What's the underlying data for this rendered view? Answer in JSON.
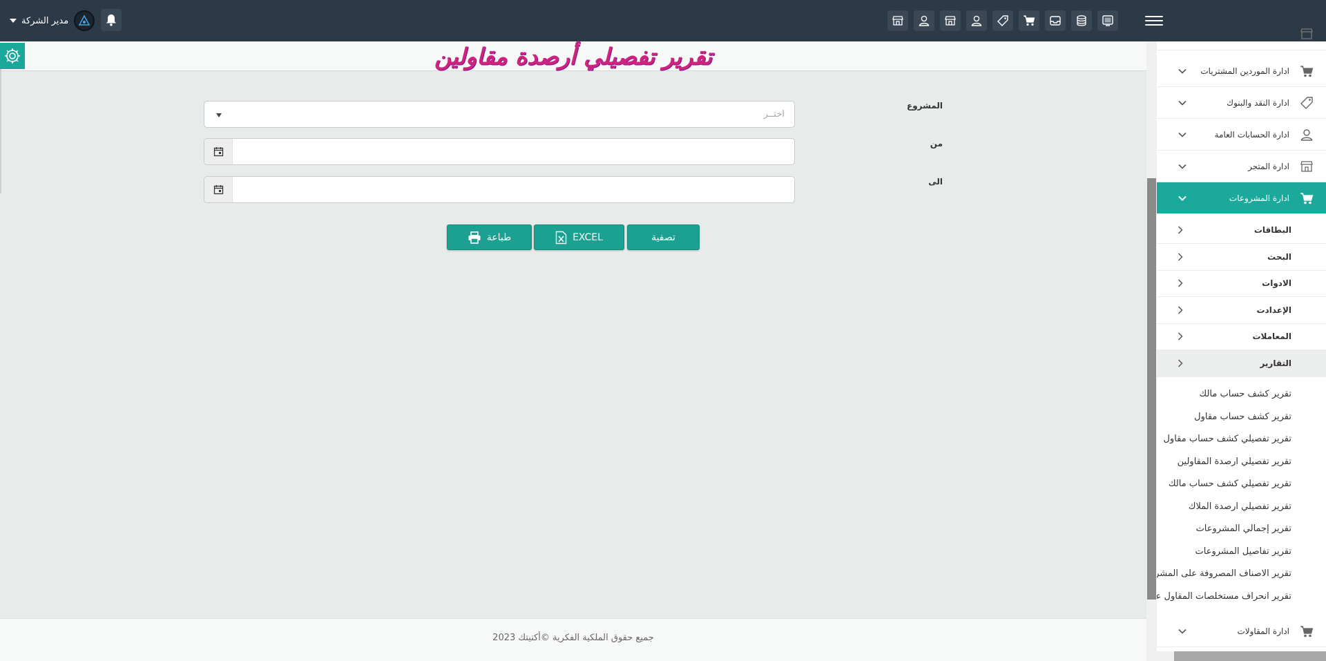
{
  "header": {
    "user_name": "مدير الشركة",
    "toolbar_icons": [
      "monitor-icon",
      "database-icon",
      "inbox-icon",
      "cart-icon",
      "tag-icon",
      "user-icon",
      "store-icon",
      "user-icon",
      "store-icon"
    ]
  },
  "page": {
    "title": "تقرير تفصيلي أرصدة مقاولين"
  },
  "form": {
    "project_label": "المشروع",
    "project_placeholder": "اختــر",
    "from_label": "من",
    "to_label": "الى",
    "from_value": "",
    "to_value": "",
    "filter_button": "تصفية",
    "excel_button": "EXCEL",
    "print_button": "طباعة"
  },
  "footer": {
    "copyright": "جميع حقوق الملكية الفكرية ©أكتيتك 2023"
  },
  "sidebar": {
    "menu": [
      {
        "label": "ادارة الموردين المشتريات",
        "icon": "cart-icon"
      },
      {
        "label": "ادارة النقد والبنوك",
        "icon": "tag-icon"
      },
      {
        "label": "ادارة الحسابات العامة",
        "icon": "user-icon"
      },
      {
        "label": "ادارة المتجر",
        "icon": "store-icon"
      },
      {
        "label": "ادارة المشروعات",
        "icon": "cart-icon"
      }
    ],
    "submenu": [
      {
        "label": "البطاقات"
      },
      {
        "label": "البحث"
      },
      {
        "label": "الادوات"
      },
      {
        "label": "الإعدادت"
      },
      {
        "label": "المعاملات"
      },
      {
        "label": "التقارير"
      }
    ],
    "reports": [
      "تقرير كشف حساب مالك",
      "تقرير كشف حساب مقاول",
      "تقرير تفصيلي كشف حساب مقاول",
      "تقرير تفصيلي ارصدة المقاولين",
      "تقرير تفصيلي كشف حساب مالك",
      "تقرير تفصيلي ارصدة الملاك",
      "تقرير إجمالي المشروعات",
      "تقرير تفاصيل المشروعات",
      "تقرير الاصناف المصروفة على المشروع",
      "تقرير انحراف مستخلصات المقاول عن المقايسة"
    ],
    "bottom_item": "ادارة المقاولات"
  },
  "colors": {
    "topbar": "#2c3a47",
    "accent": "#1ba99b",
    "title": "#d0247c"
  }
}
